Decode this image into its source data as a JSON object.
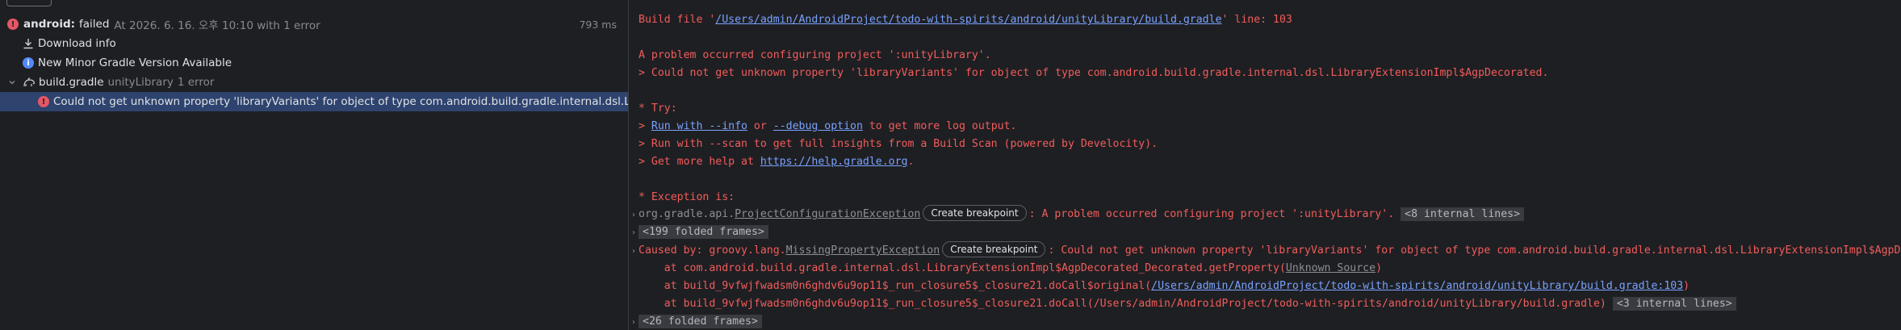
{
  "tree": {
    "root": {
      "name": "android:",
      "status": "failed",
      "meta": "At 2026. 6. 16. 오후 10:10 with 1 error",
      "duration": "793 ms"
    },
    "download_info": "Download info",
    "gradle_notice": "New Minor Gradle Version Available",
    "build_file": {
      "name": "build.gradle",
      "module": "unityLibrary",
      "errors": "1 error"
    },
    "error_item": "Could not get unknown property 'libraryVariants' for object of type com.android.build.gradle.internal.dsl.LibraryExte"
  },
  "console": {
    "build_file_prefix": "Build file '",
    "build_file_path": "/Users/admin/AndroidProject/todo-with-spirits/android/unityLibrary/build.gradle",
    "build_file_suffix": "' line: 103",
    "problem_line": "A problem occurred configuring project ':unityLibrary'.",
    "problem_detail": "> Could not get unknown property 'libraryVariants' for object of type com.android.build.gradle.internal.dsl.LibraryExtensionImpl$AgpDecorated.",
    "try_header": "* Try:",
    "try1_prefix": "> ",
    "try1_link1": "Run with --info",
    "try1_mid": " or ",
    "try1_link2": "--debug option",
    "try1_suffix": " to get more log output.",
    "try2": "> Run with --scan to get full insights from a Build Scan (powered by Develocity).",
    "try3_prefix": "> Get more help at ",
    "try3_link": "https://help.gradle.org",
    "try3_suffix": ".",
    "exception_header": "* Exception is:",
    "exc_pkg": "org.gradle.api.",
    "exc_class": "ProjectConfigurationException",
    "breakpoint_label": "Create breakpoint",
    "exc_msg": ": A problem occurred configuring project ':unityLibrary'.",
    "internal_lines_8": "<8 internal lines>",
    "folded_199": "<199 folded frames>",
    "caused_prefix": "Caused by: groovy.lang.",
    "caused_class": "MissingPropertyException",
    "caused_msg": ": Could not get unknown property 'libraryVariants' for object of type com.android.build.gradle.internal.dsl.LibraryExtensionImpl$AgpDecorat",
    "at1_prefix": "    at com.android.build.gradle.internal.dsl.LibraryExtensionImpl$AgpDecorated_Decorated.getProperty(",
    "at1_link": "Unknown Source",
    "at1_suffix": ")",
    "at2_prefix": "    at build_9vfwjfwadsm0n6ghdv6u9op11$_run_closure5$_closure21.doCall$original(",
    "at2_link": "/Users/admin/AndroidProject/todo-with-spirits/android/unityLibrary/build.gradle:103",
    "at2_suffix": ")",
    "at3": "    at build_9vfwjfwadsm0n6ghdv6u9op11$_run_closure5$_closure21.doCall(/Users/admin/AndroidProject/todo-with-spirits/android/unityLibrary/build.gradle)",
    "internal_lines_3": "<3 internal lines>",
    "folded_26": "<26 folded frames>"
  },
  "colors": {
    "error": "#f25c5c",
    "link": "#7aa2ff",
    "selection": "#2e436e",
    "background": "#1e1f22"
  },
  "icons": [
    "error-icon",
    "download-icon",
    "info-icon",
    "chevron-down-icon",
    "gradle-icon",
    "fold-arrow-icon"
  ]
}
